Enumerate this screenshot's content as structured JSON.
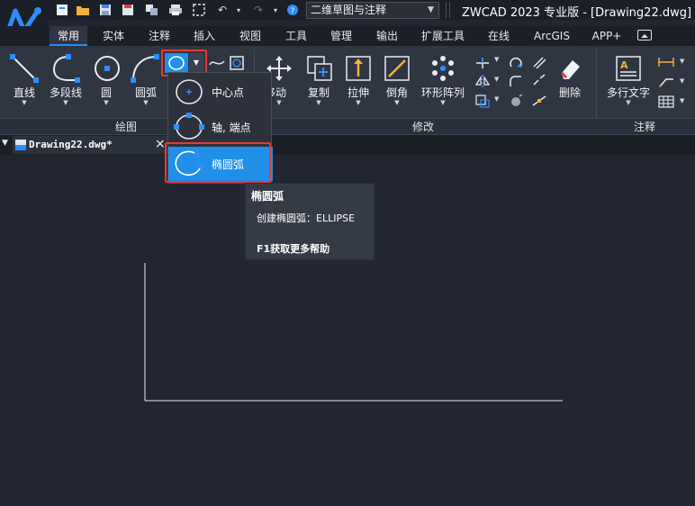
{
  "colors": {
    "accent": "#1f8fe8",
    "highlight": "#e23b3b",
    "canvas": "#212630",
    "ribbon": "#2f3541"
  },
  "quick_access": {
    "workspace": "二维草图与注释"
  },
  "app_title": "ZWCAD 2023 专业版 - [Drawing22.dwg]",
  "tabs": [
    {
      "label": "常用",
      "active": true
    },
    {
      "label": "实体"
    },
    {
      "label": "注释"
    },
    {
      "label": "插入"
    },
    {
      "label": "视图"
    },
    {
      "label": "工具"
    },
    {
      "label": "管理"
    },
    {
      "label": "输出"
    },
    {
      "label": "扩展工具"
    },
    {
      "label": "在线"
    },
    {
      "label": "ArcGIS"
    },
    {
      "label": "APP+"
    }
  ],
  "draw_tools": {
    "line": "直线",
    "polyline": "多段线",
    "circle": "圆",
    "arc": "圆弧"
  },
  "modify_tools": {
    "move": "移动",
    "copy": "复制",
    "stretch": "拉伸",
    "chamfer": "倒角",
    "array": "环形阵列",
    "erase": "删除"
  },
  "annotation_tools": {
    "mtext": "多行文字"
  },
  "groups": {
    "draw": "绘图",
    "modify": "修改",
    "annotation": "注释"
  },
  "ellipse_menu": [
    {
      "label": "中心点"
    },
    {
      "label": "轴, 端点"
    },
    {
      "label": "椭圆弧",
      "selected": true
    }
  ],
  "tooltip": {
    "title": "椭圆弧",
    "description": "创建椭圆弧：ELLIPSE",
    "help": "F1获取更多帮助"
  },
  "document": {
    "tab_name": "Drawing22.dwg*"
  }
}
